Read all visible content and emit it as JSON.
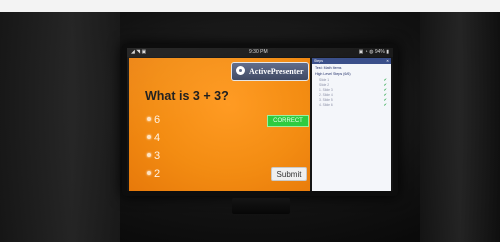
{
  "statusbar": {
    "left_icons": "◢ ◥ ▣",
    "time": "9:30 PM",
    "right_status": "▣ ◔ ◍ 94% ▮"
  },
  "slide": {
    "logo_text": "ActivePresenter",
    "question": "What is 3 + 3?",
    "options": [
      {
        "label": "6"
      },
      {
        "label": "4"
      },
      {
        "label": "3"
      },
      {
        "label": "2"
      }
    ],
    "feedback": "CORRECT",
    "submit_label": "Submit"
  },
  "panel": {
    "header": "Steps",
    "close_glyph": "✕",
    "title": "Test: Math Items",
    "subtitle": "High Level Steps (6/6)",
    "steps": [
      {
        "label": "Slide 1",
        "check": "✔"
      },
      {
        "label": "Slide 2",
        "check": "✔"
      },
      {
        "label": "1. Slide 3",
        "check": "✔"
      },
      {
        "label": "2. Slide 4",
        "check": "✔"
      },
      {
        "label": "3. Slide 5",
        "check": "✔"
      },
      {
        "label": "4. Slide 6",
        "check": "✔"
      }
    ]
  }
}
